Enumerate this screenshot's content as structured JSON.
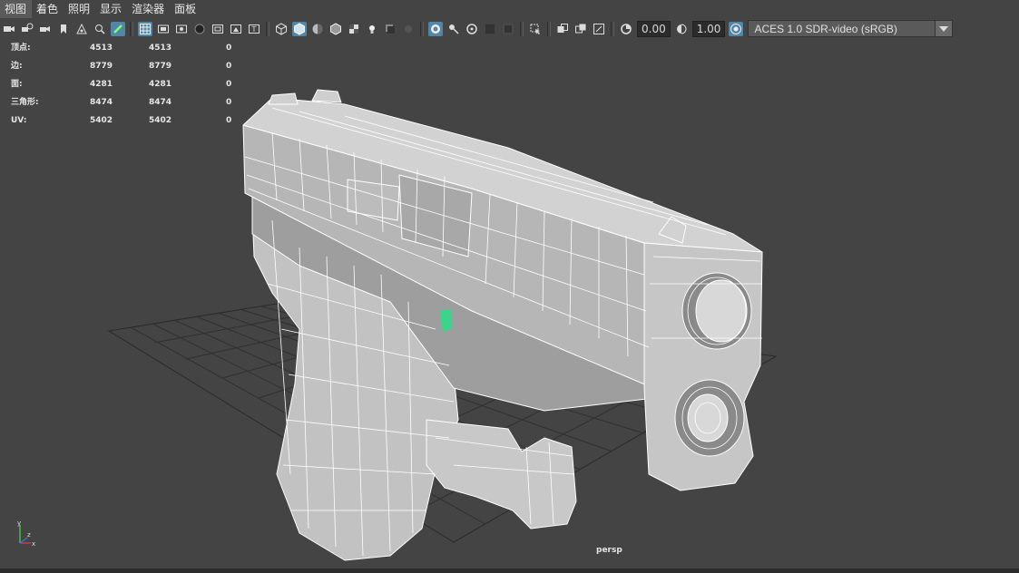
{
  "menubar": {
    "items": [
      {
        "label": "视图"
      },
      {
        "label": "着色"
      },
      {
        "label": "照明"
      },
      {
        "label": "显示"
      },
      {
        "label": "渲染器"
      },
      {
        "label": "面板"
      }
    ]
  },
  "toolbar": {
    "exposure_value": "0.00",
    "gamma_value": "1.00",
    "colorspace_value": "ACES 1.0 SDR-video (sRGB)",
    "icons": [
      "camera-icon",
      "camera-attributes-icon",
      "bookmark-icon",
      "image-plane-icon",
      "grease-pencil-icon",
      "grid-icon",
      "film-gate-icon",
      "resolution-gate-icon",
      "gate-mask-icon",
      "field-chart-icon",
      "safe-action-icon",
      "safe-title-icon",
      "wireframe-icon",
      "smooth-shade-icon",
      "default-material-icon",
      "textured-icon",
      "lights-icon",
      "shadows-icon",
      "xray-icon",
      "ambient-occlusion-icon",
      "isolate-select-icon",
      "exposure-icon",
      "gamma-icon",
      "color-management-icon"
    ],
    "active_color": "#5285a6"
  },
  "hud": {
    "rows": [
      {
        "label": "顶点:",
        "v1": "4513",
        "v2": "4513",
        "v3": "0"
      },
      {
        "label": "边:",
        "v1": "8779",
        "v2": "8779",
        "v3": "0"
      },
      {
        "label": "面:",
        "v1": "4281",
        "v2": "4281",
        "v3": "0"
      },
      {
        "label": "三角形:",
        "v1": "8474",
        "v2": "8474",
        "v3": "0"
      },
      {
        "label": "UV:",
        "v1": "5402",
        "v2": "5402",
        "v3": "0"
      }
    ]
  },
  "viewport": {
    "camera": "persp",
    "background_color": "#444444",
    "wire_color": "#ffffff",
    "selection_color": "#3ad58a"
  },
  "axis": {
    "x": "x",
    "y": "y",
    "z": "z"
  }
}
